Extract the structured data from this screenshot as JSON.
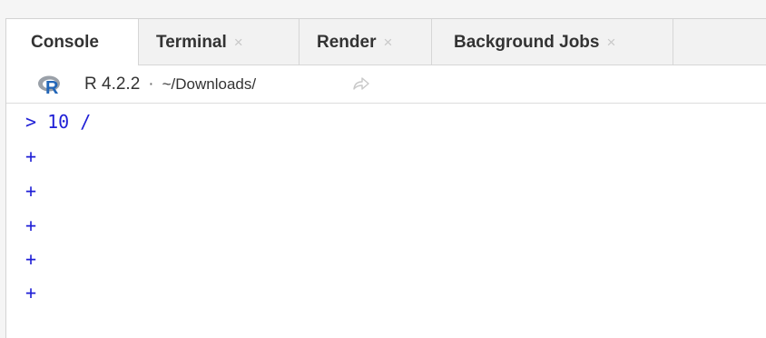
{
  "tabs": [
    {
      "label": "Console",
      "closable": false,
      "active": true
    },
    {
      "label": "Terminal",
      "closable": true,
      "active": false
    },
    {
      "label": "Render",
      "closable": true,
      "active": false
    },
    {
      "label": "Background Jobs",
      "closable": true,
      "active": false
    }
  ],
  "close_glyph": "×",
  "toolbar": {
    "r_version": "R 4.2.2",
    "separator": "·",
    "path": "~/Downloads/",
    "goto_icon": "go-to-directory-icon"
  },
  "console": {
    "lines": [
      {
        "prompt": ">",
        "text": " 10 /"
      },
      {
        "prompt": "+",
        "text": ""
      },
      {
        "prompt": "+",
        "text": ""
      },
      {
        "prompt": "+",
        "text": ""
      },
      {
        "prompt": "+",
        "text": ""
      },
      {
        "prompt": "+",
        "text": ""
      }
    ]
  },
  "colors": {
    "console_text": "#1f1fd6",
    "tab_inactive_bg": "#f2f2f2",
    "tab_active_bg": "#ffffff",
    "r_logo_blue": "#2266b8",
    "r_logo_grey": "#9aa0a8"
  }
}
